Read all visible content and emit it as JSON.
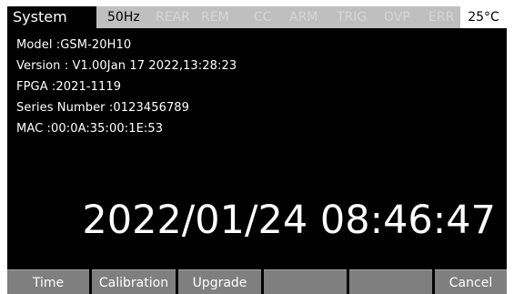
{
  "status_bar": {
    "mode": "System",
    "items": [
      {
        "label": "50Hz",
        "active": true
      },
      {
        "label": "REAR",
        "active": false
      },
      {
        "label": "REM",
        "active": false
      },
      {
        "label": "CC",
        "active": false
      },
      {
        "label": "ARM",
        "active": false
      },
      {
        "label": "TRIG",
        "active": false
      },
      {
        "label": "OVP",
        "active": false
      },
      {
        "label": "ERR",
        "active": false
      }
    ],
    "temperature": "25°C"
  },
  "info": {
    "model": "Model :GSM-20H10",
    "version": "Version : V1.00Jan 17 2022,13:28:23",
    "fpga": "FPGA :2021-1119",
    "series_number": "Series Number :0123456789",
    "mac": "MAC :00:0A:35:00:1E:53"
  },
  "datetime": "2022/01/24 08:46:47",
  "softkeys": [
    {
      "label": "Time"
    },
    {
      "label": "Calibration"
    },
    {
      "label": "Upgrade"
    },
    {
      "label": ""
    },
    {
      "label": ""
    },
    {
      "label": "Cancel"
    }
  ]
}
